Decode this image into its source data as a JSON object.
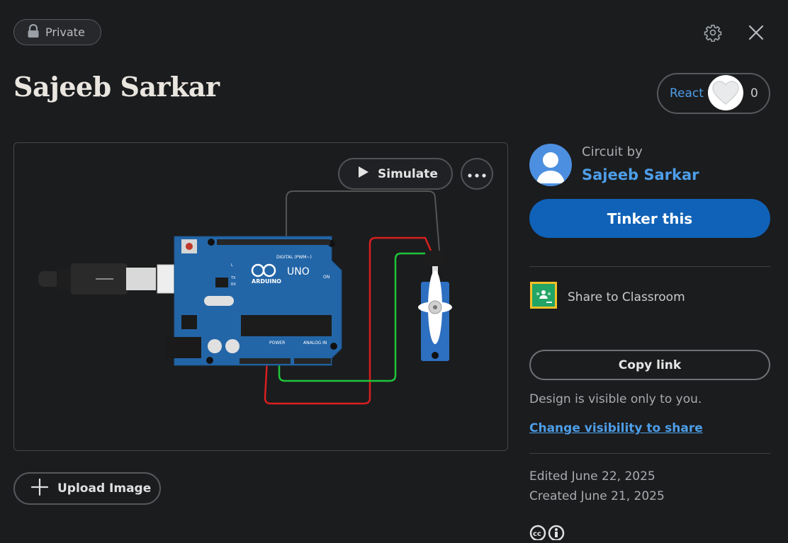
{
  "header": {
    "visibility_label": "Private",
    "title": "Sajeeb Sarkar",
    "react_label": "React",
    "react_count": "0",
    "icons": [
      "lock-icon",
      "gear-icon",
      "close-icon",
      "heart-icon"
    ]
  },
  "canvas": {
    "simulate_label": "Simulate",
    "board_brand": "ARDUINO",
    "board_model": "UNO",
    "board_digital_label": "DIGITAL (PWM~)",
    "board_power_label": "POWER",
    "board_analog_label": "ANALOG IN",
    "board_on_label": "ON",
    "board_tx_label": "TX",
    "board_rx_label": "RX",
    "board_l_label": "L",
    "wire_colors": {
      "signal": "#1fc43a",
      "power": "#d81f1f",
      "ground": "#4a4a4a"
    }
  },
  "upload_label": "Upload Image",
  "sidebar": {
    "circuit_by": "Circuit by",
    "author": "Sajeeb Sarkar",
    "tinker_label": "Tinker this",
    "share_classroom": "Share to Classroom",
    "copy_link": "Copy link",
    "visibility_note": "Design is visible only to you.",
    "change_visibility": "Change visibility to share",
    "edited": "Edited June 22, 2025",
    "created": "Created June 21, 2025"
  },
  "colors": {
    "accent": "#0f62b7",
    "link": "#4d9ee8",
    "background": "#1b1c1e"
  }
}
